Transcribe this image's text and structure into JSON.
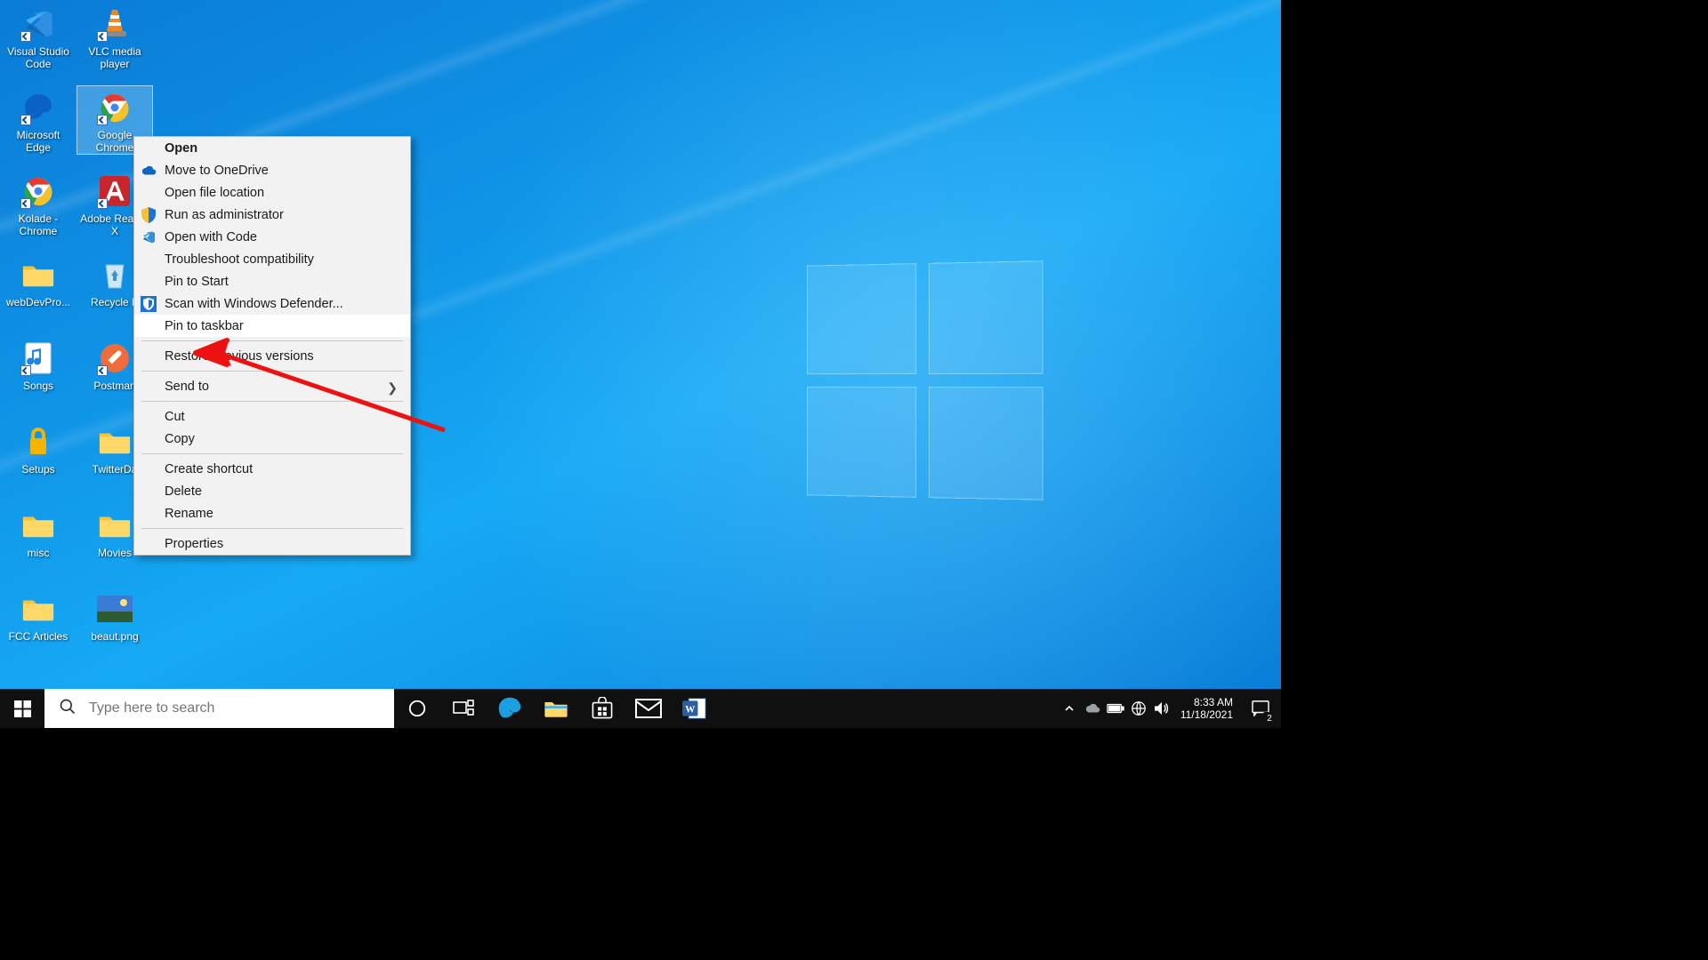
{
  "desktop_icons": {
    "col1": [
      {
        "label": "Visual Studio Code",
        "type": "vscode"
      },
      {
        "label": "Microsoft Edge",
        "type": "edge"
      },
      {
        "label": "Kolade - Chrome",
        "type": "chrome-profile"
      },
      {
        "label": "webDevPro...",
        "type": "folder"
      },
      {
        "label": "Songs",
        "type": "music-file"
      },
      {
        "label": "Setups",
        "type": "lock-folder"
      },
      {
        "label": "misc",
        "type": "folder"
      },
      {
        "label": "FCC Articles",
        "type": "folder"
      }
    ],
    "col2": [
      {
        "label": "VLC media player",
        "type": "vlc"
      },
      {
        "label": "Google Chrome",
        "type": "chrome",
        "selected": true
      },
      {
        "label": "Adobe Reader X",
        "type": "adobe"
      },
      {
        "label": "Recycle B",
        "type": "recycle"
      },
      {
        "label": "Postman",
        "type": "postman"
      },
      {
        "label": "TwitterDa",
        "type": "folder"
      },
      {
        "label": "Movies",
        "type": "folder"
      },
      {
        "label": "beaut.png",
        "type": "image"
      }
    ]
  },
  "context_menu": {
    "items": [
      {
        "label": "Open",
        "bold": true
      },
      {
        "label": "Move to OneDrive",
        "icon": "onedrive"
      },
      {
        "label": "Open file location"
      },
      {
        "label": "Run as administrator",
        "icon": "shield"
      },
      {
        "label": "Open with Code",
        "icon": "vscode"
      },
      {
        "label": "Troubleshoot compatibility"
      },
      {
        "label": "Pin to Start"
      },
      {
        "label": "Scan with Windows Defender...",
        "icon": "defender"
      },
      {
        "label": "Pin to taskbar",
        "highlight": true
      },
      {
        "sep": true
      },
      {
        "label": "Restore previous versions"
      },
      {
        "sep": true
      },
      {
        "label": "Send to",
        "submenu": true
      },
      {
        "sep": true
      },
      {
        "label": "Cut"
      },
      {
        "label": "Copy"
      },
      {
        "sep": true
      },
      {
        "label": "Create shortcut"
      },
      {
        "label": "Delete"
      },
      {
        "label": "Rename"
      },
      {
        "sep": true
      },
      {
        "label": "Properties"
      }
    ]
  },
  "taskbar": {
    "search_placeholder": "Type here to search",
    "time": "8:33 AM",
    "date": "11/18/2021",
    "notif_count": "2"
  }
}
